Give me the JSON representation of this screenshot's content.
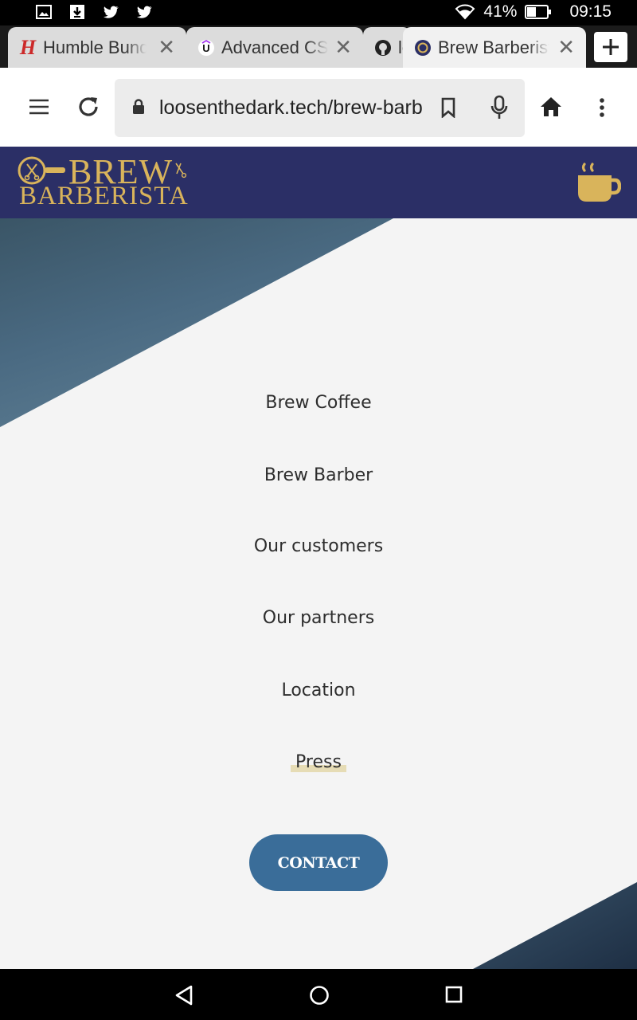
{
  "status_bar": {
    "battery": "41%",
    "time": "09:15"
  },
  "tabs": [
    {
      "title": "Humble Bundle",
      "favicon": "humble-bundle-favicon",
      "active": false
    },
    {
      "title": "Advanced CSS",
      "favicon": "udemy-favicon",
      "active": false
    },
    {
      "title": "loosenthedark",
      "favicon": "github-favicon",
      "active": false
    },
    {
      "title": "Brew Barberista",
      "favicon": "brew-barberista-favicon",
      "active": true
    }
  ],
  "address_bar": {
    "url": "loosenthedark.tech/brew-barberista/"
  },
  "site": {
    "logo_brew": "BREW",
    "logo_barberista": "BARBERISTA",
    "accent_color": "#d9b45b",
    "header_color": "#2b2f66"
  },
  "menu": {
    "items": [
      {
        "label": "Brew Coffee"
      },
      {
        "label": "Brew Barber"
      },
      {
        "label": "Our customers"
      },
      {
        "label": "Our partners"
      },
      {
        "label": "Location"
      },
      {
        "label": "Press"
      }
    ],
    "active_index": 5,
    "contact_label": "CONTACT",
    "contact_color": "#3a6d99"
  }
}
